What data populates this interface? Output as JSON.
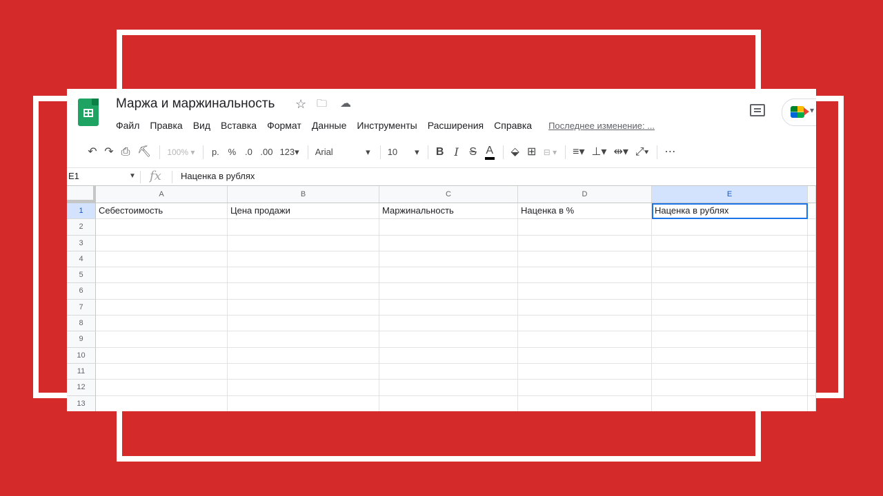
{
  "app": {
    "title": "Маржа и маржинальность",
    "last_edit": "Последнее изменение: ..."
  },
  "menu": [
    "Файл",
    "Правка",
    "Вид",
    "Вставка",
    "Формат",
    "Данные",
    "Инструменты",
    "Расширения",
    "Справка"
  ],
  "toolbar": {
    "zoom": "100%",
    "currency": "р.",
    "percent": "%",
    "dec_decrease": ".0",
    "dec_increase": ".00",
    "more_formats": "123",
    "font": "Arial",
    "font_size": "10",
    "bold": "B",
    "italic": "I",
    "strike": "S",
    "text_color": "A"
  },
  "formula_bar": {
    "name_box": "E1",
    "fx": "fx",
    "value": "Наценка в рублях"
  },
  "sheet": {
    "columns": [
      "A",
      "B",
      "C",
      "D",
      "E"
    ],
    "selected_column": "E",
    "selected_row": "1",
    "rows": [
      "1",
      "2",
      "3",
      "4",
      "5",
      "6",
      "7",
      "8",
      "9",
      "10",
      "11",
      "12",
      "13"
    ],
    "row1": [
      "Себестоимость",
      "Цена продажи",
      "Маржинальность",
      "Наценка в %",
      "Наценка в рублях"
    ]
  },
  "colors": {
    "background": "#d42a2a",
    "sheets_green": "#1ea362",
    "selection_blue": "#1a73e8"
  }
}
